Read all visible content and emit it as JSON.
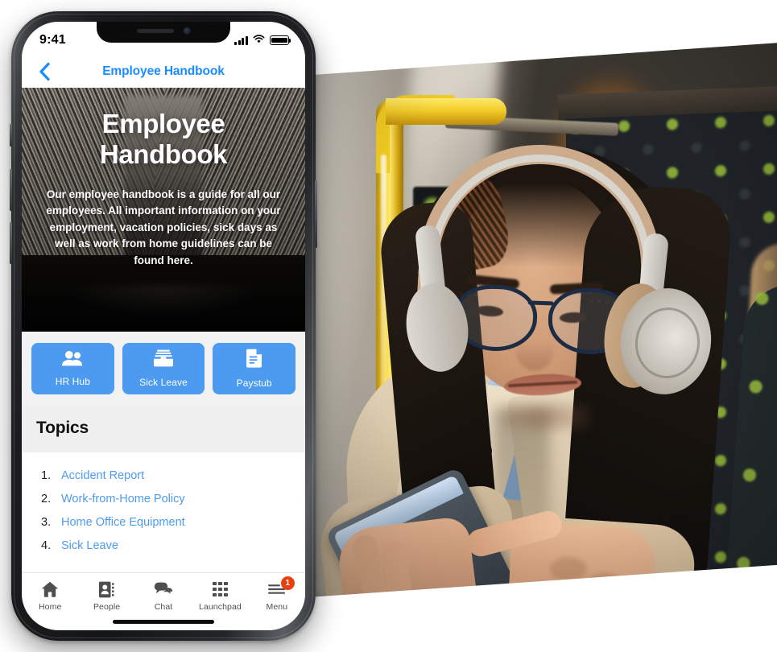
{
  "status_bar": {
    "time": "9:41",
    "signal_icon": "cellular-signal-icon",
    "wifi_icon": "wifi-icon",
    "battery_icon": "battery-icon"
  },
  "nav": {
    "back_icon": "chevron-left-icon",
    "title": "Employee Handbook"
  },
  "hero": {
    "title_line1": "Employee",
    "title_line2": "Handbook",
    "paragraph": "Our employee handbook is a guide for all our employees.\nAll important information on your employment, vacation policies, sick days as well as work from home guidelines can be found here.",
    "background_description": "open-book-photo"
  },
  "quick_actions": [
    {
      "label": "HR Hub",
      "icon": "people-icon"
    },
    {
      "label": "Sick Leave",
      "icon": "inbox-tray-icon"
    },
    {
      "label": "Paystub",
      "icon": "document-icon"
    }
  ],
  "topics": {
    "heading": "Topics",
    "items": [
      {
        "number": "1.",
        "label": "Accident Report"
      },
      {
        "number": "2.",
        "label": "Work-from-Home Policy"
      },
      {
        "number": "3.",
        "label": "Home Office Equipment"
      },
      {
        "number": "4.",
        "label": "Sick Leave"
      }
    ]
  },
  "tab_bar": [
    {
      "label": "Home",
      "icon": "home-icon",
      "badge": ""
    },
    {
      "label": "People",
      "icon": "contacts-icon",
      "badge": ""
    },
    {
      "label": "Chat",
      "icon": "chat-bubbles-icon",
      "badge": ""
    },
    {
      "label": "Launchpad",
      "icon": "grid-apps-icon",
      "badge": ""
    },
    {
      "label": "Menu",
      "icon": "hamburger-menu-icon",
      "badge": "1"
    }
  ],
  "photo": {
    "description": "woman-with-headphones-using-phone-on-bus"
  },
  "colors": {
    "accent_blue": "#4d9bf0",
    "ios_blue": "#1a8cff",
    "badge_red": "#e8400f",
    "panel_gray": "#efefef",
    "actions_bg": "#f2f2f2"
  }
}
